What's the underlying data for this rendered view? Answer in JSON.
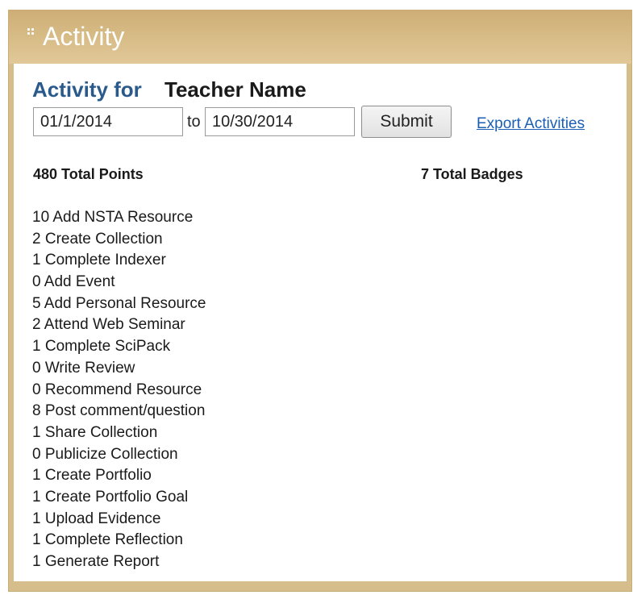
{
  "header": {
    "title": "Activity",
    "grip_icon": "grip-dots-icon",
    "colors": {
      "header_bg": "#d6bd8c",
      "title_text": "#ffffff"
    }
  },
  "filter": {
    "activity_for_label": "Activity for",
    "teacher_name": "Teacher Name",
    "from_date": "01/1/2014",
    "to_label": "to",
    "to_date": "10/30/2014",
    "submit_label": "Submit",
    "export_label": "Export Activities"
  },
  "totals": {
    "points": "480 Total Points",
    "badges": "7 Total Badges"
  },
  "activities": [
    "10 Add NSTA Resource",
    "2 Create Collection",
    "1 Complete Indexer",
    "0 Add Event",
    "5 Add Personal Resource",
    "2 Attend Web Seminar",
    "1 Complete SciPack",
    "0 Write Review",
    "0 Recommend Resource",
    "8 Post comment/question",
    "1 Share Collection",
    "0 Publicize Collection",
    "1 Create Portfolio",
    "1 Create Portfolio Goal",
    "1 Upload Evidence",
    "1 Complete Reflection",
    "1 Generate Report"
  ],
  "colors": {
    "accent_heading": "#2a5a8c",
    "link": "#1a5fb4"
  }
}
